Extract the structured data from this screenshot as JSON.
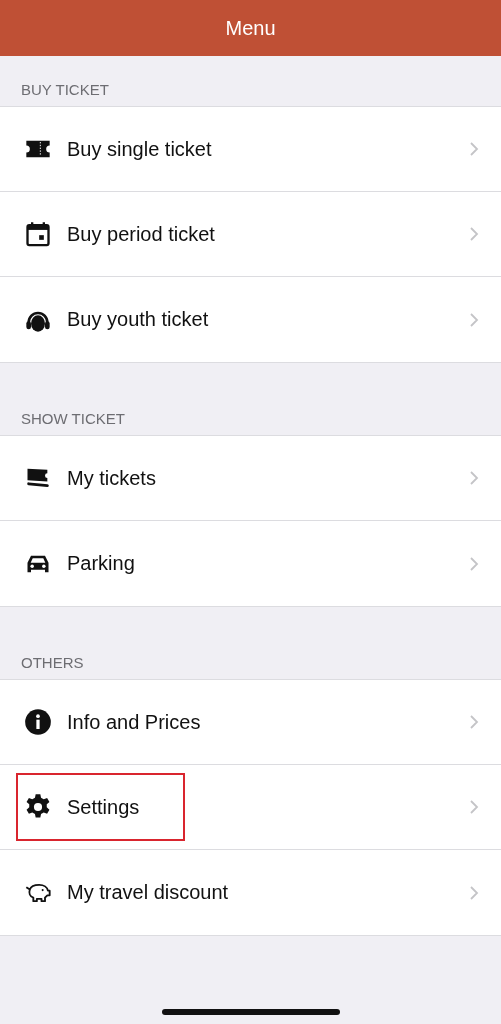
{
  "header": {
    "title": "Menu"
  },
  "sections": [
    {
      "title": "BUY TICKET",
      "items": [
        {
          "label": "Buy single ticket",
          "highlighted": false
        },
        {
          "label": "Buy period ticket",
          "highlighted": false
        },
        {
          "label": "Buy youth ticket",
          "highlighted": false
        }
      ]
    },
    {
      "title": "SHOW TICKET",
      "items": [
        {
          "label": "My tickets",
          "highlighted": false
        },
        {
          "label": "Parking",
          "highlighted": false
        }
      ]
    },
    {
      "title": "OTHERS",
      "items": [
        {
          "label": "Info and Prices",
          "highlighted": false
        },
        {
          "label": "Settings",
          "highlighted": true
        },
        {
          "label": "My travel discount",
          "highlighted": false
        }
      ]
    }
  ]
}
